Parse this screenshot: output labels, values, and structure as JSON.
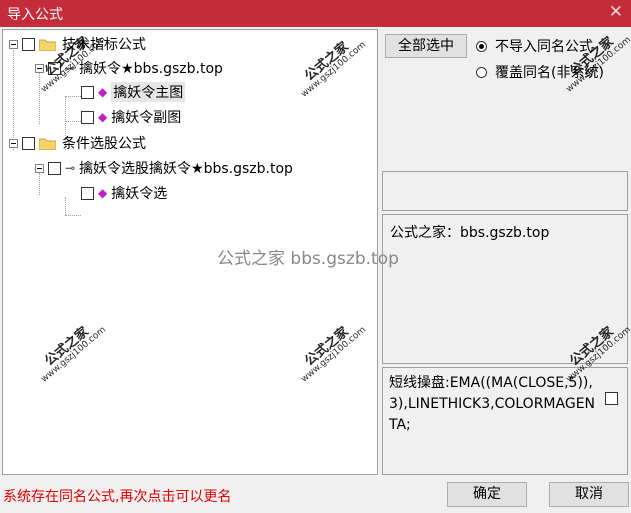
{
  "window": {
    "title": "导入公式",
    "close_glyph": "✕"
  },
  "tree": {
    "group1": {
      "label": "技术指标公式"
    },
    "formula1": {
      "label": "擒妖令★bbs.gszb.top",
      "children": [
        "擒妖令主图",
        "擒妖令副图"
      ]
    },
    "group2": {
      "label": "条件选股公式"
    },
    "formula2": {
      "label": "擒妖令选股擒妖令★bbs.gszb.top",
      "children": [
        "擒妖令选"
      ]
    }
  },
  "controls": {
    "select_all": "全部选中",
    "radio_skip": "不导入同名公式",
    "radio_overwrite": "覆盖同名(非系统)",
    "radio_selected": "skip"
  },
  "info": {
    "site": "公式之家：bbs.gszb.top"
  },
  "code": {
    "text": "短线操盘:EMA((MA(CLOSE,5)),3),LINETHICK3,COLORMAGENTA;"
  },
  "status": {
    "message": "系统存在同名公式,再次点击可以更名"
  },
  "buttons": {
    "ok": "确定",
    "cancel": "取消"
  },
  "watermark": {
    "center": "公式之家 bbs.gszb.top",
    "stamp_title": "公式之家",
    "stamp_url": "www.gszj100.com"
  }
}
